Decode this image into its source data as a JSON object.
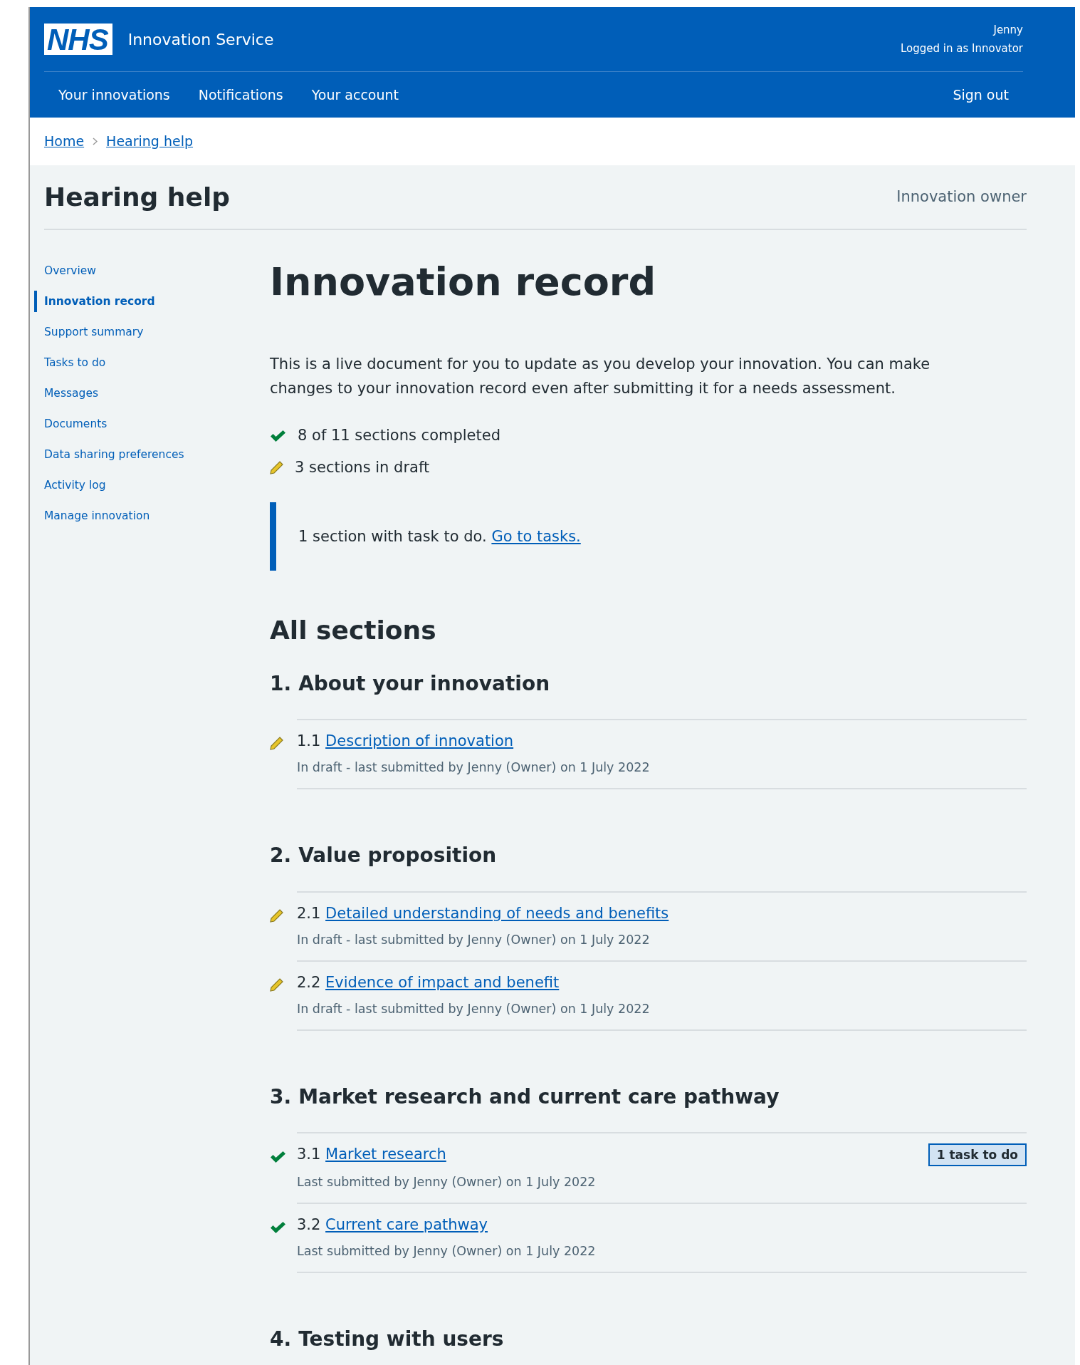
{
  "header": {
    "logo": "NHS",
    "service": "Innovation Service",
    "user_name": "Jenny",
    "user_role": "Logged in as Innovator"
  },
  "nav": [
    {
      "label": "Your innovations"
    },
    {
      "label": "Notifications"
    },
    {
      "label": "Your account"
    }
  ],
  "sign_out": "Sign out",
  "breadcrumbs": [
    "Home",
    "Hearing help"
  ],
  "innovation_title": "Hearing help",
  "role_label": "Innovation owner",
  "sidebar": {
    "items": [
      {
        "label": "Overview",
        "selected": false
      },
      {
        "label": "Innovation record",
        "selected": true
      },
      {
        "label": "Support summary",
        "selected": false
      },
      {
        "label": "Tasks to do",
        "selected": false
      },
      {
        "label": "Messages",
        "selected": false
      },
      {
        "label": "Documents",
        "selected": false
      },
      {
        "label": "Data sharing preferences",
        "selected": false
      },
      {
        "label": "Activity log",
        "selected": false
      },
      {
        "label": "Manage innovation",
        "selected": false
      }
    ]
  },
  "page_title": "Innovation record",
  "intro": "This is a live document for you to update as you develop your innovation. You can make changes to your innovation record even after submitting it for a needs assessment.",
  "summary": [
    {
      "kind": "complete",
      "text": "8 of 11 sections completed"
    },
    {
      "kind": "draft",
      "text": "3 sections in draft"
    }
  ],
  "inset": {
    "text": "1 section with task to do.",
    "link": "Go to tasks."
  },
  "all_sections_title": "All sections",
  "sections": [
    {
      "number": "1.",
      "title": "About your innovation",
      "items": [
        {
          "number": "1.1",
          "title": "Description of innovation",
          "kind": "draft",
          "meta": "In draft - last submitted by Jenny (Owner) on 1 July 2022"
        }
      ]
    },
    {
      "number": "2.",
      "title": "Value proposition",
      "items": [
        {
          "number": "2.1",
          "title": "Detailed understanding of needs and benefits",
          "kind": "draft",
          "meta": "In draft - last submitted by Jenny (Owner) on 1 July 2022"
        },
        {
          "number": "2.2",
          "title": "Evidence of impact and benefit",
          "kind": "draft",
          "meta": "In draft - last submitted by Jenny (Owner) on 1 July 2022"
        }
      ]
    },
    {
      "number": "3.",
      "title": "Market research and current care pathway",
      "items": [
        {
          "number": "3.1",
          "title": "Market research",
          "kind": "complete",
          "meta": "Last submitted by Jenny (Owner) on 1 July 2022",
          "badge": "1 task to do"
        },
        {
          "number": "3.2",
          "title": "Current care pathway",
          "kind": "complete",
          "meta": "Last submitted by Jenny (Owner) on 1 July 2022"
        }
      ]
    },
    {
      "number": "4.",
      "title": "Testing with users"
    }
  ]
}
